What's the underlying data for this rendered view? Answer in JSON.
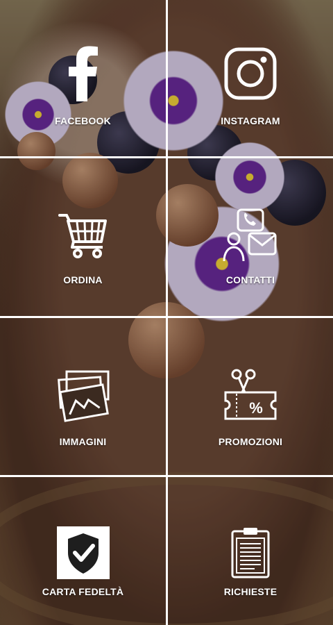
{
  "tiles": [
    {
      "label": "FACEBOOK",
      "icon": "facebook-icon"
    },
    {
      "label": "INSTAGRAM",
      "icon": "instagram-icon"
    },
    {
      "label": "ORDINA",
      "icon": "shopping-cart-icon"
    },
    {
      "label": "CONTATTI",
      "icon": "contacts-icon"
    },
    {
      "label": "IMMAGINI",
      "icon": "images-icon"
    },
    {
      "label": "PROMOZIONI",
      "icon": "promotion-coupon-icon"
    },
    {
      "label": "CARTA FEDELTÀ",
      "icon": "loyalty-card-shield-icon"
    },
    {
      "label": "RICHIESTE",
      "icon": "clipboard-requests-icon"
    }
  ],
  "colors": {
    "grid_lines": "#ffffff",
    "label_text": "#ffffff"
  }
}
